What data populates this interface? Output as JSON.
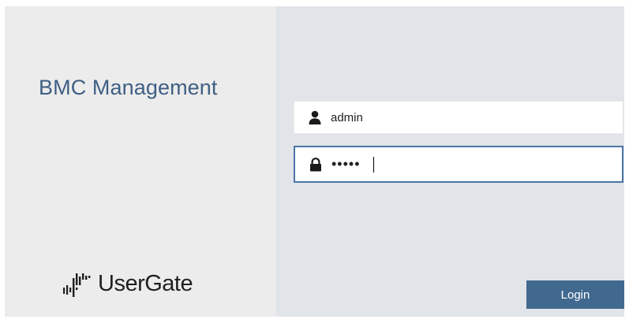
{
  "app": {
    "title": "BMC Management"
  },
  "brand": {
    "name": "UserGate",
    "logo_icon": "usergate-bars-icon",
    "text_color": "#1f1f1f"
  },
  "colors": {
    "title": "#3f5f84",
    "accent": "#41698f",
    "focus_border": "#4a74a8",
    "left_bg": "#ececec",
    "right_bg": "#e1e4e8"
  },
  "form": {
    "username": {
      "icon": "user-icon",
      "value": "admin"
    },
    "password": {
      "icon": "lock-icon",
      "value": "•••••"
    },
    "login_label": "Login"
  }
}
